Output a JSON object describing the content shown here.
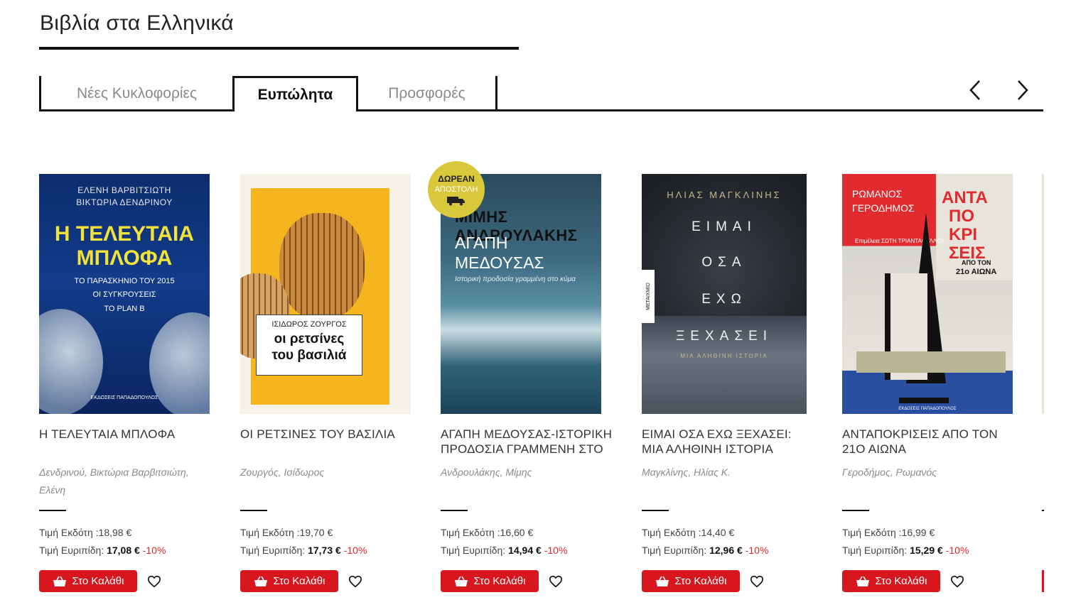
{
  "section": {
    "title": "Βιβλία στα Ελληνικά"
  },
  "tabs": [
    "Νέες Κυκλοφορίες",
    "Ευπώλητα",
    "Προσφορές"
  ],
  "active_tab": "Ευπώλητα",
  "nav": {
    "prev_icon": "chevron-left-icon",
    "next_icon": "chevron-right-icon"
  },
  "badge": {
    "line1": "ΔΩΡΕΑΝ",
    "line2": "ΑΠΟΣΤΟΛΗ",
    "icon": "truck-icon"
  },
  "labels": {
    "publisher_price": "Τιμή Εκδότη :",
    "store_price": "Τιμή Ευριπίδη: ",
    "cart": "Στο Καλάθι"
  },
  "colors": {
    "accent": "#d8161d",
    "discount": "#e3262b",
    "badge": "#d9c83b"
  },
  "products": [
    {
      "title": "Η ΤΕΛΕΥΤΑΙΑ ΜΠΛΟΦΑ",
      "author": "Δενδρινού, Βικτώρια Βαρβιτσιώτη, Ελένη",
      "price_publisher": "18,98 €",
      "price_store": "17,08 €",
      "discount": "-10%",
      "cover": {
        "authors_line1": "ΕΛΕΝΗ ΒΑΡΒΙΤΣΙΩΤΗ",
        "authors_line2": "ΒΙΚΤΩΡΙΑ ΔΕΝΔΡΙΝΟΥ",
        "title_line1": "Η ΤΕΛΕΥΤΑΙΑ",
        "title_line2": "ΜΠΛΟΦΑ",
        "sub1": "ΤΟ ΠΑΡΑΣΚΗΝΙΟ ΤΟΥ 2015",
        "sub2": "ΟΙ ΣΥΓΚΡΟΥΣΕΙΣ",
        "sub3": "ΤΟ PLAN B",
        "publisher": "ΕΚΔΟΣΕΙΣ ΠΑΠΑΔΟΠΟΥΛΟΣ"
      }
    },
    {
      "title": "ΟΙ ΡΕΤΣΙΝΕΣ ΤΟΥ ΒΑΣΙΛΙΑ",
      "author": "Ζουργός, Ισίδωρος",
      "price_publisher": "19,70 €",
      "price_store": "17,73 €",
      "discount": "-10%",
      "cover": {
        "author": "ΙΣΙΔΩΡΟΣ ΖΟΥΡΓΟΣ",
        "title_line1": "οι ρετσίνες",
        "title_line2": "του βασιλιά"
      }
    },
    {
      "title": "ΑΓΑΠΗ ΜΕΔΟΥΣΑΣ-ΙΣΤΟΡΙΚΗ ΠΡΟΔΟΣΙΑ ΓΡΑΜΜΕΝΗ ΣΤΟ ΚΥΜΑ",
      "author": "Ανδρουλάκης, Μίμης",
      "price_publisher": "16,60 €",
      "price_store": "14,94 €",
      "discount": "-10%",
      "cover": {
        "author": "ΜΙΜΗΣ ΑΝΔΡΟΥΛΑΚΗΣ",
        "title_line1": "ΑΓΑΠΗ",
        "title_line2": "ΜΕΔΟΥΣΑΣ",
        "subtitle": "Ιστορική προδοσία γραμμένη στο κύμα"
      }
    },
    {
      "title": "ΕΙΜΑΙ ΟΣΑ ΕΧΩ ΞΕΧΑΣΕΙ: ΜΙΑ ΑΛΗΘΙΝΗ ΙΣΤΟΡΙΑ",
      "author": "Μαγκλίνης, Ηλίας Κ.",
      "price_publisher": "14,40 €",
      "price_store": "12,96 €",
      "discount": "-10%",
      "cover": {
        "author": "ΗΛΙΑΣ ΜΑΓΚΛΙΝΗΣ",
        "w1": "ΕΙΜΑΙ",
        "w2": "ΟΣΑ",
        "w3": "ΕΧΩ",
        "w4": "ΞΕΧΑΣΕΙ",
        "sub": "ΜΙΑ ΑΛΗΘΙΝΗ ΙΣΤΟΡΙΑ",
        "publisher": "ΜΕΤΑΙΧΜΙΟ"
      }
    },
    {
      "title": "ΑΝΤΑΠΟΚΡΙΣΕΙΣ ΑΠΟ ΤΟΝ 21Ο ΑΙΩΝΑ",
      "author": "Γεροδήμος, Ρωμανός",
      "price_publisher": "16,99 €",
      "price_store": "15,29 €",
      "discount": "-10%",
      "cover": {
        "author1": "ΡΩΜΑΝΟΣ",
        "author2": "ΓΕΡΟΔΗΜΟΣ",
        "t1": "ΑΝΤΑ",
        "t2": "ΠΟ",
        "t3": "ΚΡΙ",
        "t4": "ΣΕΙΣ",
        "sub1": "ΑΠΟ ΤΟΝ",
        "sub2": "21ο ΑΙΩΝΑ",
        "editor": "Επιμέλεια ΣΩΤΗ ΤΡΙΑΝΤΑΦΥΛΛΟΥ",
        "publisher": "ΕΚΔΟΣΕΙΣ ΠΑΠΑΔΟΠΟΥΛΟΣ"
      }
    }
  ]
}
